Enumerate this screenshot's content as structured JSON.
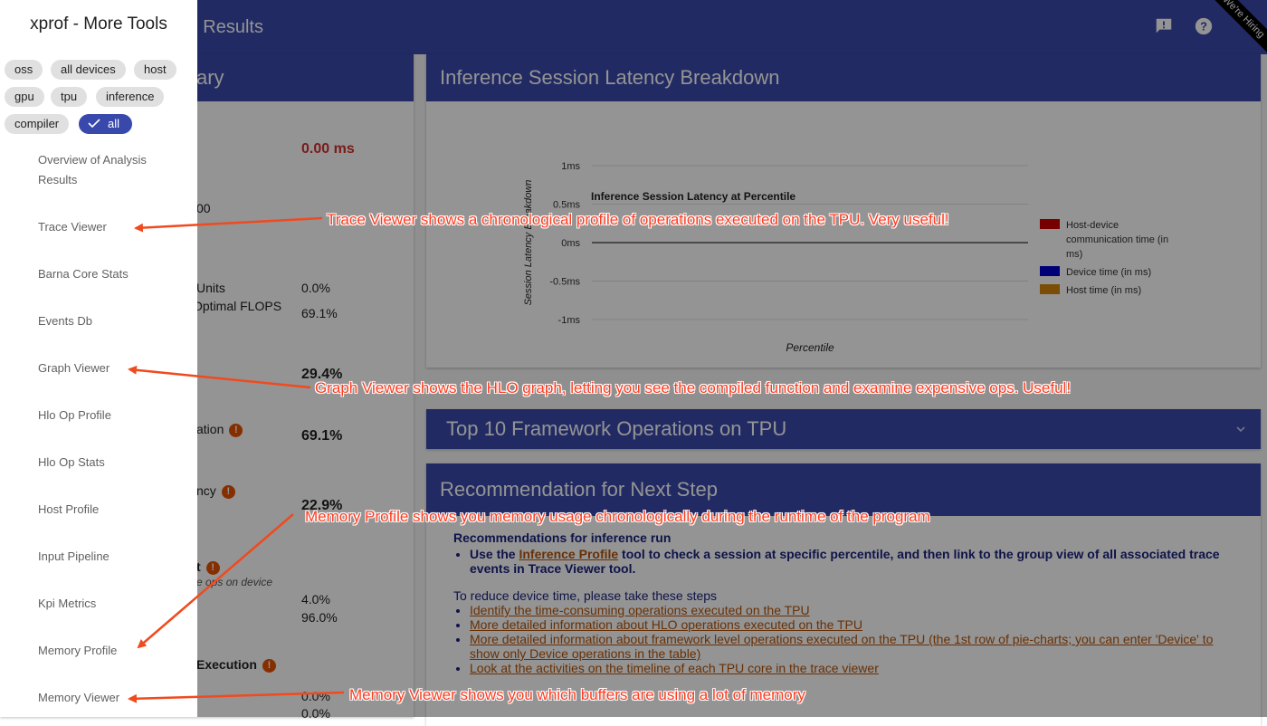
{
  "topbar": {
    "title": "ew of Analysis Results",
    "hiring": "We're Hiring"
  },
  "left_panel": {
    "header": "ary",
    "row_value_red": "0.00 ms",
    "row_00": "00",
    "units_label": "Units",
    "units_value": "0.0%",
    "flops_label": "Optimal FLOPS",
    "flops_value": "69.1%",
    "pct_a": "29.4%",
    "ation_label": "ation",
    "pct_b": "69.1%",
    "ncy_label": "ncy",
    "pct_c": "22.9%",
    "t_label": "t",
    "ops_on_device": "e ops on device",
    "pct_d": "4.0%",
    "pct_e": "96.0%",
    "execution_label": "Execution",
    "pct_f": "0.0%",
    "pct_g": "0.0%"
  },
  "latency_card": {
    "header": "Inference Session Latency Breakdown"
  },
  "chart_data": {
    "type": "line",
    "title": "Inference Session Latency at Percentile",
    "xlabel": "Percentile",
    "ylabel": "Session Latency Breakdown",
    "yticks": [
      "1ms",
      "0.5ms",
      "0ms",
      "-0.5ms",
      "-1ms"
    ],
    "ylim": [
      -1,
      1
    ],
    "series": [
      {
        "name": "Host-device communication time (in ms)",
        "color": "#cc0000",
        "values": []
      },
      {
        "name": "Device time (in ms)",
        "color": "#0000cc",
        "values": []
      },
      {
        "name": "Host time (in ms)",
        "color": "#d4860b",
        "values": []
      }
    ],
    "legend_position": "right"
  },
  "topops_card": {
    "header": "Top 10 Framework Operations on TPU"
  },
  "recommendation": {
    "header": "Recommendation for Next Step",
    "subtitle": "Recommendations for inference run",
    "use_the": "Use the",
    "inference_profile_link": "Inference Profile",
    "use_rest": " tool to check a session at specific percentile, and then link to the group view of all associated trace events in Trace Viewer tool.",
    "reduce_title": "To reduce device time, please take these steps",
    "steps": [
      "Identify the time-consuming operations executed on the TPU",
      "More detailed information about HLO operations executed on the TPU",
      "More detailed information about framework level operations executed on the TPU (the 1st row of pie-charts; you can enter 'Device' to show only Device operations in the table)",
      "Look at the activities on the timeline of each TPU core in the trace viewer"
    ]
  },
  "drawer": {
    "title": "xprof - More Tools",
    "chips": [
      "oss",
      "all devices",
      "host",
      "gpu",
      "tpu",
      "inference",
      "compiler",
      "all"
    ],
    "nav": [
      "Overview of Analysis Results",
      "Trace Viewer",
      "Barna Core Stats",
      "Events Db",
      "Graph Viewer",
      "Hlo Op Profile",
      "Hlo Op Stats",
      "Host Profile",
      "Input Pipeline",
      "Kpi Metrics",
      "Memory Profile",
      "Memory Viewer"
    ]
  },
  "annotations": {
    "trace": "Trace Viewer shows a chronological profile of operations executed on the TPU. Very useful!",
    "graph": "Graph Viewer shows the HLO graph, letting you see the compiled function and examine expensive ops. Useful!",
    "memprofile": "Memory Profile shows you memory usage chronologically during the runtime of the program",
    "memviewer": "Memory Viewer shows you which buffers are using a lot of memory",
    "arrow_color": "#f04a1e"
  },
  "icons": [
    "feedback-icon",
    "help-icon",
    "check-icon",
    "info-icon",
    "chevron-down-icon"
  ]
}
